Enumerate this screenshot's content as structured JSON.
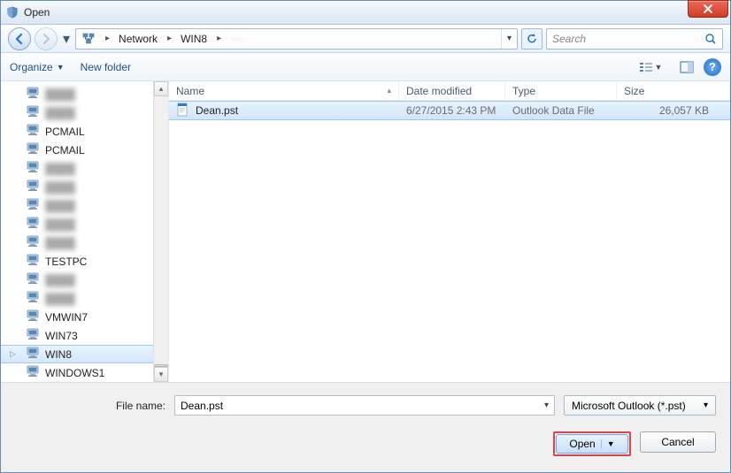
{
  "title": "Open",
  "breadcrumb": {
    "root": "Network",
    "level1": "WIN8",
    "level2_obscured": "····"
  },
  "search": {
    "placeholder": "Search"
  },
  "toolbar": {
    "organize": "Organize",
    "new_folder": "New folder"
  },
  "columns": {
    "name": "Name",
    "date": "Date modified",
    "type": "Type",
    "size": "Size"
  },
  "tree": [
    {
      "label": "",
      "blurred": true
    },
    {
      "label": "",
      "blurred": true
    },
    {
      "label": "PCMAIL",
      "blurred": false
    },
    {
      "label": "PCMAIL",
      "blurred": false
    },
    {
      "label": "",
      "blurred": true
    },
    {
      "label": "",
      "blurred": true
    },
    {
      "label": "",
      "blurred": true
    },
    {
      "label": "",
      "blurred": true
    },
    {
      "label": "",
      "blurred": true
    },
    {
      "label": "TESTPC",
      "blurred": false
    },
    {
      "label": "",
      "blurred": true
    },
    {
      "label": "",
      "blurred": true
    },
    {
      "label": "VMWIN7",
      "blurred": false
    },
    {
      "label": "WIN73",
      "blurred": false
    },
    {
      "label": "WIN8",
      "blurred": false,
      "selected": true,
      "expandable": true
    },
    {
      "label": "WINDOWS1",
      "blurred": false
    },
    {
      "label": "",
      "blurred": true
    }
  ],
  "files": [
    {
      "name": "Dean.pst",
      "date": "6/27/2015 2:43 PM",
      "type": "Outlook Data File",
      "size": "26,057 KB",
      "selected": true
    }
  ],
  "footer": {
    "filename_label": "File name:",
    "filename_value": "Dean.pst",
    "filter": "Microsoft Outlook (*.pst)",
    "open": "Open",
    "cancel": "Cancel"
  }
}
